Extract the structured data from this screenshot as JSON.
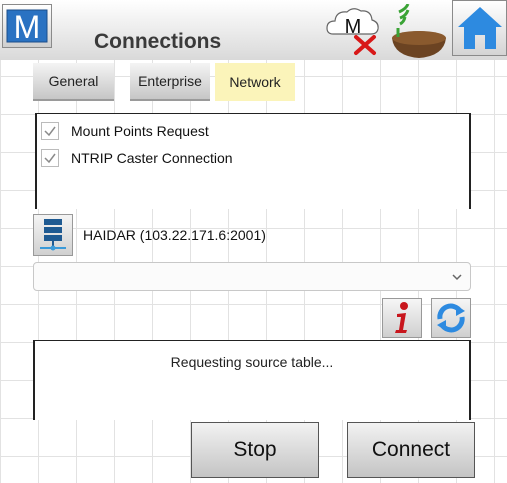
{
  "header": {
    "title": "Connections",
    "logo_icon": "m-logo-icon",
    "cloud_status_icon": "cloud-disconnected-icon",
    "gnss_status_icon": "gnss-antenna-icon",
    "home_icon": "home-icon",
    "logo_letter": "M",
    "cloud_letter": "M"
  },
  "tabs": [
    {
      "label": "General",
      "active": false
    },
    {
      "label": "Enterprise",
      "active": false
    },
    {
      "label": "Network",
      "active": true
    }
  ],
  "checklist": [
    {
      "label": "Mount Points Request",
      "checked": true
    },
    {
      "label": "NTRIP Caster Connection",
      "checked": true
    }
  ],
  "caster": {
    "label": "HAIDAR (103.22.171.6:2001)",
    "icon": "server-icon"
  },
  "mount_point_select": {
    "value": ""
  },
  "status": {
    "message": "Requesting source table..."
  },
  "buttons": {
    "stop": "Stop",
    "connect": "Connect"
  },
  "colors": {
    "active_tab": "#fbf4ba",
    "accent_blue": "#2d8ae0",
    "info_red": "#c8161d",
    "status_red": "#d81818",
    "status_green": "#3aa335"
  }
}
